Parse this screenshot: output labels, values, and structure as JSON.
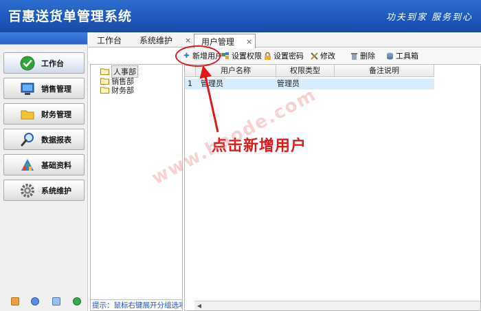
{
  "app": {
    "title": "百惠送货单管理系统",
    "slogan": "功夫到家 服务到心"
  },
  "sidebar": {
    "items": [
      {
        "label": "工作台",
        "icon": "check-circle-icon",
        "active": true
      },
      {
        "label": "销售管理",
        "icon": "monitor-icon",
        "active": false
      },
      {
        "label": "财务管理",
        "icon": "folder-icon",
        "active": false
      },
      {
        "label": "数据报表",
        "icon": "magnifier-icon",
        "active": false
      },
      {
        "label": "基础资料",
        "icon": "building-blocks-icon",
        "active": false
      },
      {
        "label": "系统维护",
        "icon": "gear-icon",
        "active": false
      }
    ],
    "bottom_icons": [
      "lock-icon",
      "clock-icon",
      "monitor-small-icon",
      "exit-icon"
    ]
  },
  "tabs": [
    {
      "label": "工作台",
      "closable": false
    },
    {
      "label": "系统维护",
      "closable": true
    },
    {
      "label": "用户管理",
      "closable": true,
      "active": true
    }
  ],
  "toolbar": {
    "items": [
      {
        "label": "新增用户",
        "icon": "plus-icon"
      },
      {
        "label": "设置权限",
        "icon": "permission-icon"
      },
      {
        "label": "设置密码",
        "icon": "lock-icon"
      },
      {
        "label": "修改",
        "icon": "tools-icon"
      },
      {
        "label": "删除",
        "icon": "trash-icon"
      },
      {
        "label": "工具箱",
        "icon": "database-icon"
      }
    ]
  },
  "tree": {
    "nodes": [
      "人事部",
      "销售部",
      "财务部"
    ],
    "selected": "人事部",
    "hint": "提示：鼠标右键展开分组选项"
  },
  "grid": {
    "columns": [
      "用户名称",
      "权限类型",
      "备注说明"
    ],
    "rows": [
      {
        "num": "1",
        "name": "管理员",
        "type": "管理员",
        "note": ""
      }
    ]
  },
  "annotation": {
    "text": "点击新增用户",
    "watermark": "www.haode.com"
  },
  "colors": {
    "header_blue": "#1f58bd",
    "annotation_red": "#e31919",
    "hint_blue": "#2a57c8",
    "row_selected": "#d9ecfb"
  }
}
